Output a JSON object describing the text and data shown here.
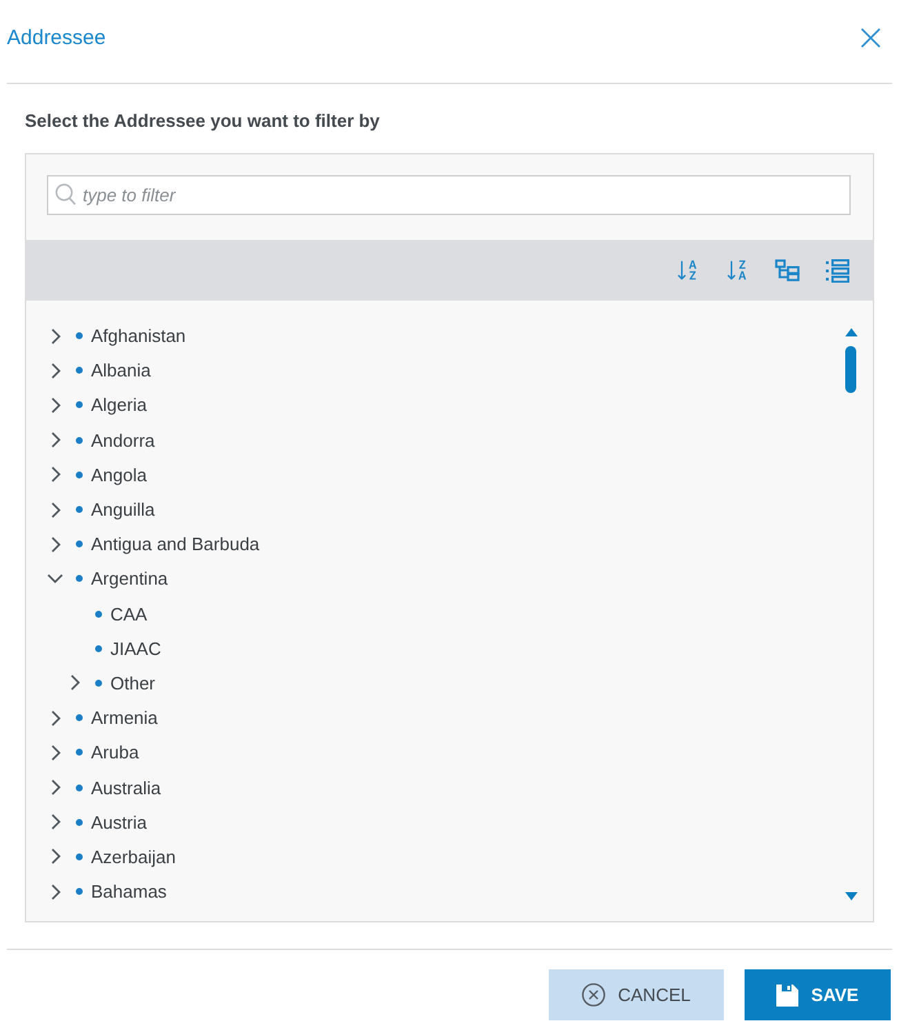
{
  "dialog": {
    "title": "Addressee"
  },
  "instruction": "Select the Addressee you want to filter by",
  "filter": {
    "placeholder": "type to filter"
  },
  "tree": [
    {
      "label": "Afghanistan",
      "expanded": false
    },
    {
      "label": "Albania",
      "expanded": false
    },
    {
      "label": "Algeria",
      "expanded": false
    },
    {
      "label": "Andorra",
      "expanded": false
    },
    {
      "label": "Angola",
      "expanded": false
    },
    {
      "label": "Anguilla",
      "expanded": false
    },
    {
      "label": "Antigua and Barbuda",
      "expanded": false
    },
    {
      "label": "Argentina",
      "expanded": true,
      "children": [
        {
          "label": "CAA"
        },
        {
          "label": "JIAAC"
        },
        {
          "label": "Other",
          "expanded": false
        }
      ]
    },
    {
      "label": "Armenia",
      "expanded": false
    },
    {
      "label": "Aruba",
      "expanded": false
    },
    {
      "label": "Australia",
      "expanded": false
    },
    {
      "label": "Austria",
      "expanded": false
    },
    {
      "label": "Azerbaijan",
      "expanded": false
    },
    {
      "label": "Bahamas",
      "expanded": false
    }
  ],
  "buttons": [
    {
      "label": "CANCEL",
      "kind": "cancel"
    },
    {
      "label": "SAVE",
      "kind": "save"
    }
  ]
}
